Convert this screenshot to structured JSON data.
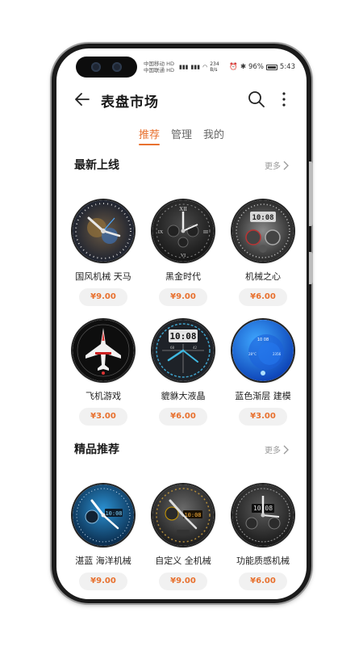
{
  "status_bar": {
    "carrier1": "中国移动 HD",
    "carrier2": "中国联通 HD",
    "net_speed": "234",
    "net_unit": "B/s",
    "battery": "96%",
    "time": "5:43"
  },
  "header": {
    "title": "表盘市场",
    "back_icon": "back-arrow-icon",
    "search_icon": "search-icon",
    "more_icon": "more-vertical-icon"
  },
  "tabs": [
    {
      "label": "推荐",
      "active": true
    },
    {
      "label": "管理",
      "active": false
    },
    {
      "label": "我的",
      "active": false
    }
  ],
  "sections": [
    {
      "title": "最新上线",
      "more": "更多",
      "items": [
        {
          "name": "国风机械 天马",
          "price": "¥9.00"
        },
        {
          "name": "黑金时代",
          "price": "¥9.00"
        },
        {
          "name": "机械之心",
          "price": "¥6.00"
        },
        {
          "name": "飞机游戏",
          "price": "¥3.00"
        },
        {
          "name": "貔貅大液晶",
          "price": "¥6.00"
        },
        {
          "name": "蓝色渐层 建模",
          "price": "¥3.00"
        }
      ]
    },
    {
      "title": "精品推荐",
      "more": "更多",
      "items": [
        {
          "name": "湛蓝 海洋机械",
          "price": "¥9.00"
        },
        {
          "name": "自定义 全机械",
          "price": "¥9.00"
        },
        {
          "name": "功能质感机械",
          "price": "¥6.00"
        }
      ]
    }
  ],
  "colors": {
    "accent": "#e8712f"
  }
}
